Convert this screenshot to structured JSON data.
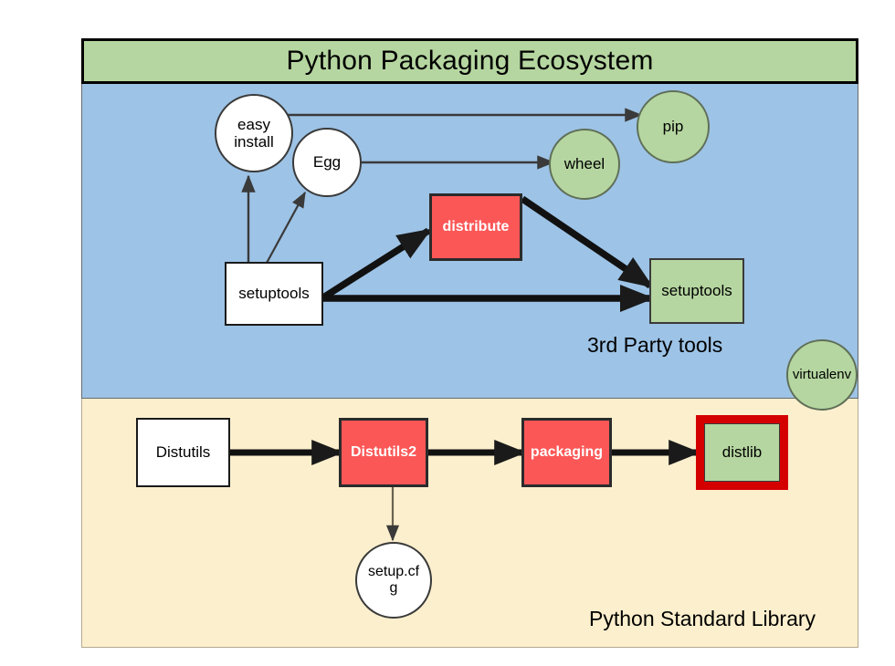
{
  "diagram": {
    "title": "Python Packaging Ecosystem",
    "bands": {
      "third_party_label": "3rd Party tools",
      "stdlib_label": "Python Standard Library"
    },
    "colors": {
      "title_green": "#b5d6a0",
      "third_party_blue": "#9dc3e6",
      "stdlib_cream": "#fcefcd",
      "red_fill": "#fb5757",
      "green_fill": "#b5d6a0",
      "white_fill": "#ffffff",
      "red_ring": "#d40000",
      "edge_dark": "#2b2b2b"
    },
    "nodes": [
      {
        "id": "easy-install",
        "label": "easy install",
        "label_line1": "easy",
        "label_line2": "install",
        "shape": "circle",
        "fill": "white",
        "band": "third-party"
      },
      {
        "id": "egg",
        "label": "Egg",
        "shape": "circle",
        "fill": "white",
        "band": "third-party"
      },
      {
        "id": "pip",
        "label": "pip",
        "shape": "circle",
        "fill": "green",
        "band": "third-party"
      },
      {
        "id": "wheel",
        "label": "wheel",
        "shape": "circle",
        "fill": "green",
        "band": "third-party"
      },
      {
        "id": "distribute",
        "label": "distribute",
        "shape": "box",
        "fill": "red",
        "band": "third-party"
      },
      {
        "id": "setuptools-src",
        "label": "setuptools",
        "shape": "box",
        "fill": "white",
        "band": "third-party"
      },
      {
        "id": "setuptools-dst",
        "label": "setuptools",
        "shape": "box",
        "fill": "green",
        "band": "third-party"
      },
      {
        "id": "virtualenv",
        "label": "virtualenv",
        "shape": "circle",
        "fill": "green",
        "band": "boundary"
      },
      {
        "id": "distutils",
        "label": "Distutils",
        "shape": "box",
        "fill": "white",
        "band": "stdlib"
      },
      {
        "id": "distutils2",
        "label": "Distutils2",
        "shape": "box",
        "fill": "red",
        "band": "stdlib"
      },
      {
        "id": "packaging",
        "label": "packaging",
        "shape": "box",
        "fill": "red",
        "band": "stdlib"
      },
      {
        "id": "distlib",
        "label": "distlib",
        "shape": "box",
        "fill": "green-red-ring",
        "band": "stdlib"
      },
      {
        "id": "setup-cfg",
        "label": "setup.cfg",
        "label_line1": "setup.cf",
        "label_line2": "g",
        "shape": "circle",
        "fill": "white",
        "band": "stdlib"
      }
    ],
    "edges": [
      {
        "from": "setuptools-src",
        "to": "easy-install",
        "weight": "thin"
      },
      {
        "from": "setuptools-src",
        "to": "egg",
        "weight": "thin"
      },
      {
        "from": "easy-install",
        "to": "pip",
        "weight": "thin"
      },
      {
        "from": "egg",
        "to": "wheel",
        "weight": "thin"
      },
      {
        "from": "setuptools-src",
        "to": "distribute",
        "weight": "thick"
      },
      {
        "from": "distribute",
        "to": "setuptools-dst",
        "weight": "thick"
      },
      {
        "from": "setuptools-src",
        "to": "setuptools-dst",
        "weight": "thick"
      },
      {
        "from": "distutils",
        "to": "distutils2",
        "weight": "thick"
      },
      {
        "from": "distutils2",
        "to": "packaging",
        "weight": "thick"
      },
      {
        "from": "packaging",
        "to": "distlib",
        "weight": "thick"
      },
      {
        "from": "distutils2",
        "to": "setup-cfg",
        "weight": "thin"
      }
    ]
  }
}
